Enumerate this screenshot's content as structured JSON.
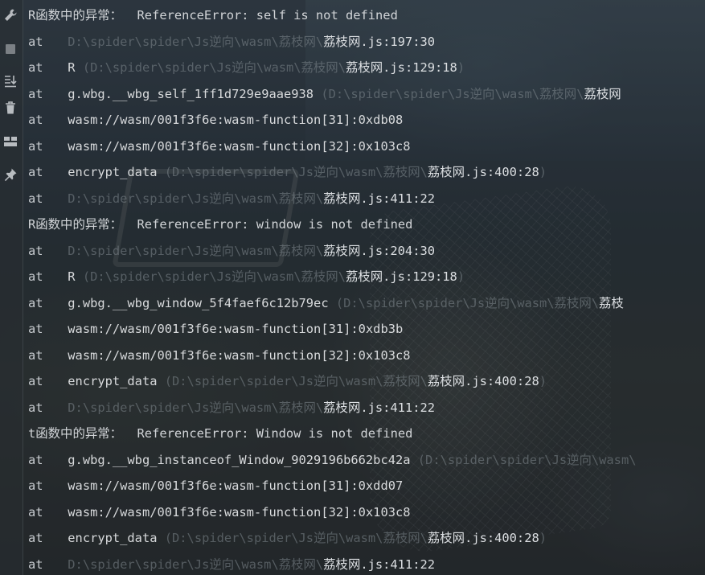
{
  "toolbar": {
    "icons": [
      "wrench-icon",
      "stop-icon",
      "scroll-to-end-icon",
      "trash-icon",
      "layout-icon",
      "pin-icon"
    ]
  },
  "console": {
    "lines": [
      {
        "type": "head",
        "text": "R函数中的异常：  ReferenceError: self is not defined"
      },
      {
        "type": "frame",
        "at": "at",
        "fn": "",
        "path_dim": "D:\\spider\\spider\\Js逆向\\wasm\\荔枝网\\",
        "path_tail": "荔枝网.js:197:30",
        "close": ""
      },
      {
        "type": "frame",
        "at": "at",
        "fn": "R ",
        "path_dim": "(D:\\spider\\spider\\Js逆向\\wasm\\荔枝网\\",
        "path_tail": "荔枝网.js:129:18",
        "close": ")"
      },
      {
        "type": "frame",
        "at": "at",
        "fn": "g.wbg.__wbg_self_1ff1d729e9aae938 ",
        "path_dim": "(D:\\spider\\spider\\Js逆向\\wasm\\荔枝网\\",
        "path_tail": "荔枝网",
        "close": ""
      },
      {
        "type": "frame",
        "at": "at",
        "fn": "wasm://wasm/001f3f6e:wasm-function[31]:0xdb08",
        "path_dim": "",
        "path_tail": "",
        "close": ""
      },
      {
        "type": "frame",
        "at": "at",
        "fn": "wasm://wasm/001f3f6e:wasm-function[32]:0x103c8",
        "path_dim": "",
        "path_tail": "",
        "close": ""
      },
      {
        "type": "frame",
        "at": "at",
        "fn": "encrypt_data ",
        "path_dim": "(D:\\spider\\spider\\Js逆向\\wasm\\荔枝网\\",
        "path_tail": "荔枝网.js:400:28",
        "close": ")"
      },
      {
        "type": "frame",
        "at": "at",
        "fn": "",
        "path_dim": "D:\\spider\\spider\\Js逆向\\wasm\\荔枝网\\",
        "path_tail": "荔枝网.js:411:22",
        "close": ""
      },
      {
        "type": "head",
        "text": "R函数中的异常：  ReferenceError: window is not defined"
      },
      {
        "type": "frame",
        "at": "at",
        "fn": "",
        "path_dim": "D:\\spider\\spider\\Js逆向\\wasm\\荔枝网\\",
        "path_tail": "荔枝网.js:204:30",
        "close": ""
      },
      {
        "type": "frame",
        "at": "at",
        "fn": "R ",
        "path_dim": "(D:\\spider\\spider\\Js逆向\\wasm\\荔枝网\\",
        "path_tail": "荔枝网.js:129:18",
        "close": ")"
      },
      {
        "type": "frame",
        "at": "at",
        "fn": "g.wbg.__wbg_window_5f4faef6c12b79ec ",
        "path_dim": "(D:\\spider\\spider\\Js逆向\\wasm\\荔枝网\\",
        "path_tail": "荔枝",
        "close": ""
      },
      {
        "type": "frame",
        "at": "at",
        "fn": "wasm://wasm/001f3f6e:wasm-function[31]:0xdb3b",
        "path_dim": "",
        "path_tail": "",
        "close": ""
      },
      {
        "type": "frame",
        "at": "at",
        "fn": "wasm://wasm/001f3f6e:wasm-function[32]:0x103c8",
        "path_dim": "",
        "path_tail": "",
        "close": ""
      },
      {
        "type": "frame",
        "at": "at",
        "fn": "encrypt_data ",
        "path_dim": "(D:\\spider\\spider\\Js逆向\\wasm\\荔枝网\\",
        "path_tail": "荔枝网.js:400:28",
        "close": ")"
      },
      {
        "type": "frame",
        "at": "at",
        "fn": "",
        "path_dim": "D:\\spider\\spider\\Js逆向\\wasm\\荔枝网\\",
        "path_tail": "荔枝网.js:411:22",
        "close": ""
      },
      {
        "type": "head",
        "text": "t函数中的异常：  ReferenceError: Window is not defined"
      },
      {
        "type": "frame",
        "at": "at",
        "fn": "g.wbg.__wbg_instanceof_Window_9029196b662bc42a ",
        "path_dim": "(D:\\spider\\spider\\Js逆向\\wasm\\",
        "path_tail": "",
        "close": ""
      },
      {
        "type": "frame",
        "at": "at",
        "fn": "wasm://wasm/001f3f6e:wasm-function[31]:0xdd07",
        "path_dim": "",
        "path_tail": "",
        "close": ""
      },
      {
        "type": "frame",
        "at": "at",
        "fn": "wasm://wasm/001f3f6e:wasm-function[32]:0x103c8",
        "path_dim": "",
        "path_tail": "",
        "close": ""
      },
      {
        "type": "frame",
        "at": "at",
        "fn": "encrypt_data ",
        "path_dim": "(D:\\spider\\spider\\Js逆向\\wasm\\荔枝网\\",
        "path_tail": "荔枝网.js:400:28",
        "close": ")"
      },
      {
        "type": "frame",
        "at": "at",
        "fn": "",
        "path_dim": "D:\\spider\\spider\\Js逆向\\wasm\\荔枝网\\",
        "path_tail": "荔枝网.js:411:22",
        "close": ""
      }
    ]
  }
}
